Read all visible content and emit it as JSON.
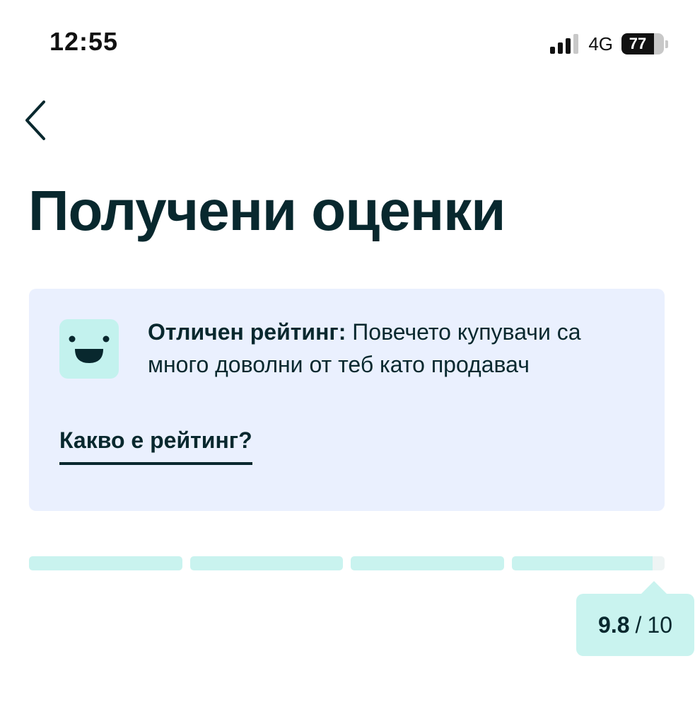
{
  "status_bar": {
    "time": "12:55",
    "network": "4G",
    "battery_level": "77",
    "battery_fraction": 0.77
  },
  "header": {
    "back_icon": "chevron-left-icon",
    "title": "Получени оценки"
  },
  "rating_card": {
    "icon": "smiley-face-icon",
    "label_bold": "Отличен рейтинг:",
    "description": " Повечето купувачи са много доволни от теб като продавач",
    "link_label": "Какво е рейтинг?"
  },
  "rating_bar": {
    "segments": 4,
    "value": 9.8,
    "max": 10
  },
  "score": {
    "value": "9.8",
    "separator": "/",
    "max": "10"
  },
  "colors": {
    "text_dark": "#08282e",
    "card_background": "#eaf0fe",
    "accent_mint": "#c9f3ef"
  }
}
